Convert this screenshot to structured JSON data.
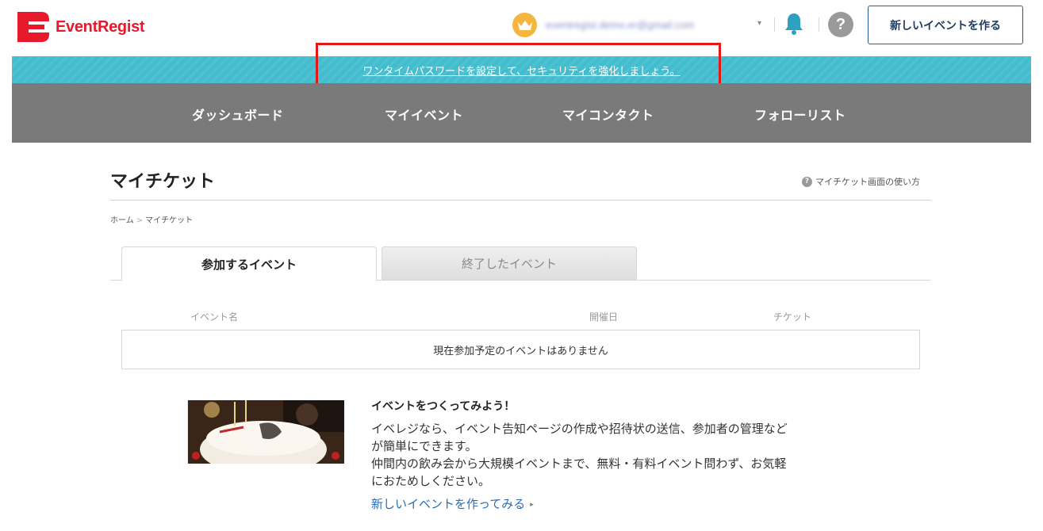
{
  "header": {
    "logo_text": "EventRegist",
    "account_email": "eventregist.demo.er@gmail.com",
    "account_caret": "▾",
    "help_label": "?",
    "new_event_button": "新しいイベントを作る",
    "brand_color": "#e8192c"
  },
  "notice": {
    "text": "ワンタイムパスワードを設定して、セキュリティを強化しましょう。",
    "color": "#43bccd"
  },
  "nav": {
    "items": [
      {
        "label": "ダッシュボード"
      },
      {
        "label": "マイイベント"
      },
      {
        "label": "マイコンタクト"
      },
      {
        "label": "フォローリスト"
      }
    ]
  },
  "page": {
    "title": "マイチケット",
    "help_link": "マイチケット画面の使い方",
    "breadcrumb": {
      "home": "ホーム",
      "separator": ">",
      "current": "マイチケット"
    }
  },
  "tabs": [
    {
      "label": "参加するイベント",
      "active": true
    },
    {
      "label": "終了したイベント",
      "active": false
    }
  ],
  "table": {
    "columns": [
      "イベント名",
      "開催日",
      "チケット"
    ],
    "empty_message": "現在参加予定のイベントはありません"
  },
  "promo": {
    "title": "イベントをつくってみよう！",
    "text_line1": "イベレジなら、イベント告知ページの作成や招待状の送信、参加者の管理など",
    "text_line2": "が簡単にできます。",
    "text_line3": "仲間内の飲み会から大規模イベントまで、無料・有料イベント問わず、お気軽",
    "text_line4": "におためしください。",
    "link": "新しいイベントを作ってみる",
    "link_arrow": "▸"
  }
}
